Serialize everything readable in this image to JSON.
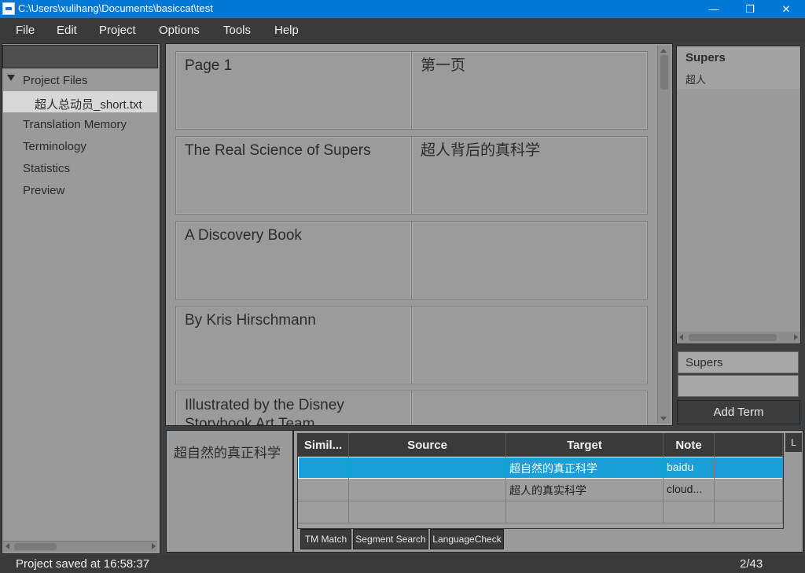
{
  "window": {
    "title": "C:\\Users\\xulihang\\Documents\\basiccat\\test",
    "minimize_glyph": "—",
    "maximize_glyph": "❐",
    "close_glyph": "✕"
  },
  "menu": [
    "File",
    "Edit",
    "Project",
    "Options",
    "Tools",
    "Help"
  ],
  "project_tree": {
    "root_label": "Project Files",
    "file_label": "超人总动员_short.txt",
    "items": [
      "Translation Memory",
      "Terminology",
      "Statistics",
      "Preview"
    ]
  },
  "segments": [
    {
      "source": "Page 1",
      "target": "第一页"
    },
    {
      "source": "The Real Science of Supers",
      "target": "超人背后的真科学"
    },
    {
      "source": "A Discovery Book",
      "target": ""
    },
    {
      "source": "By Kris Hirschmann",
      "target": ""
    },
    {
      "source": "Illustrated by the Disney Storybook Art Team",
      "target": ""
    }
  ],
  "terms": {
    "source": "Supers",
    "target": "超人",
    "input_source": "Supers",
    "input_target": "",
    "add_button": "Add Term"
  },
  "current_segment_source": "超自然的真正科学",
  "match_table": {
    "headers": [
      "Simil...",
      "Source",
      "Target",
      "Note",
      ""
    ],
    "rows": [
      {
        "similarity": "",
        "source": "",
        "target": "超自然的真正科学",
        "note": "baidu",
        "extra": ""
      },
      {
        "similarity": "",
        "source": "",
        "target": "超人的真实科学",
        "note": "cloud...",
        "extra": ""
      },
      {
        "similarity": "",
        "source": "",
        "target": "",
        "note": "",
        "extra": ""
      }
    ],
    "side_tab": "L"
  },
  "bottom_tabs": [
    "TM Match",
    "Segment Search",
    "LanguageCheck"
  ],
  "status": {
    "message": "Project saved at 16:58:37",
    "count": "2/43"
  },
  "colors": {
    "title_bar": "#0078d7",
    "selection": "#1a9fd8",
    "panel": "#9a9a9a",
    "dark_chrome": "#3a3a3a"
  }
}
